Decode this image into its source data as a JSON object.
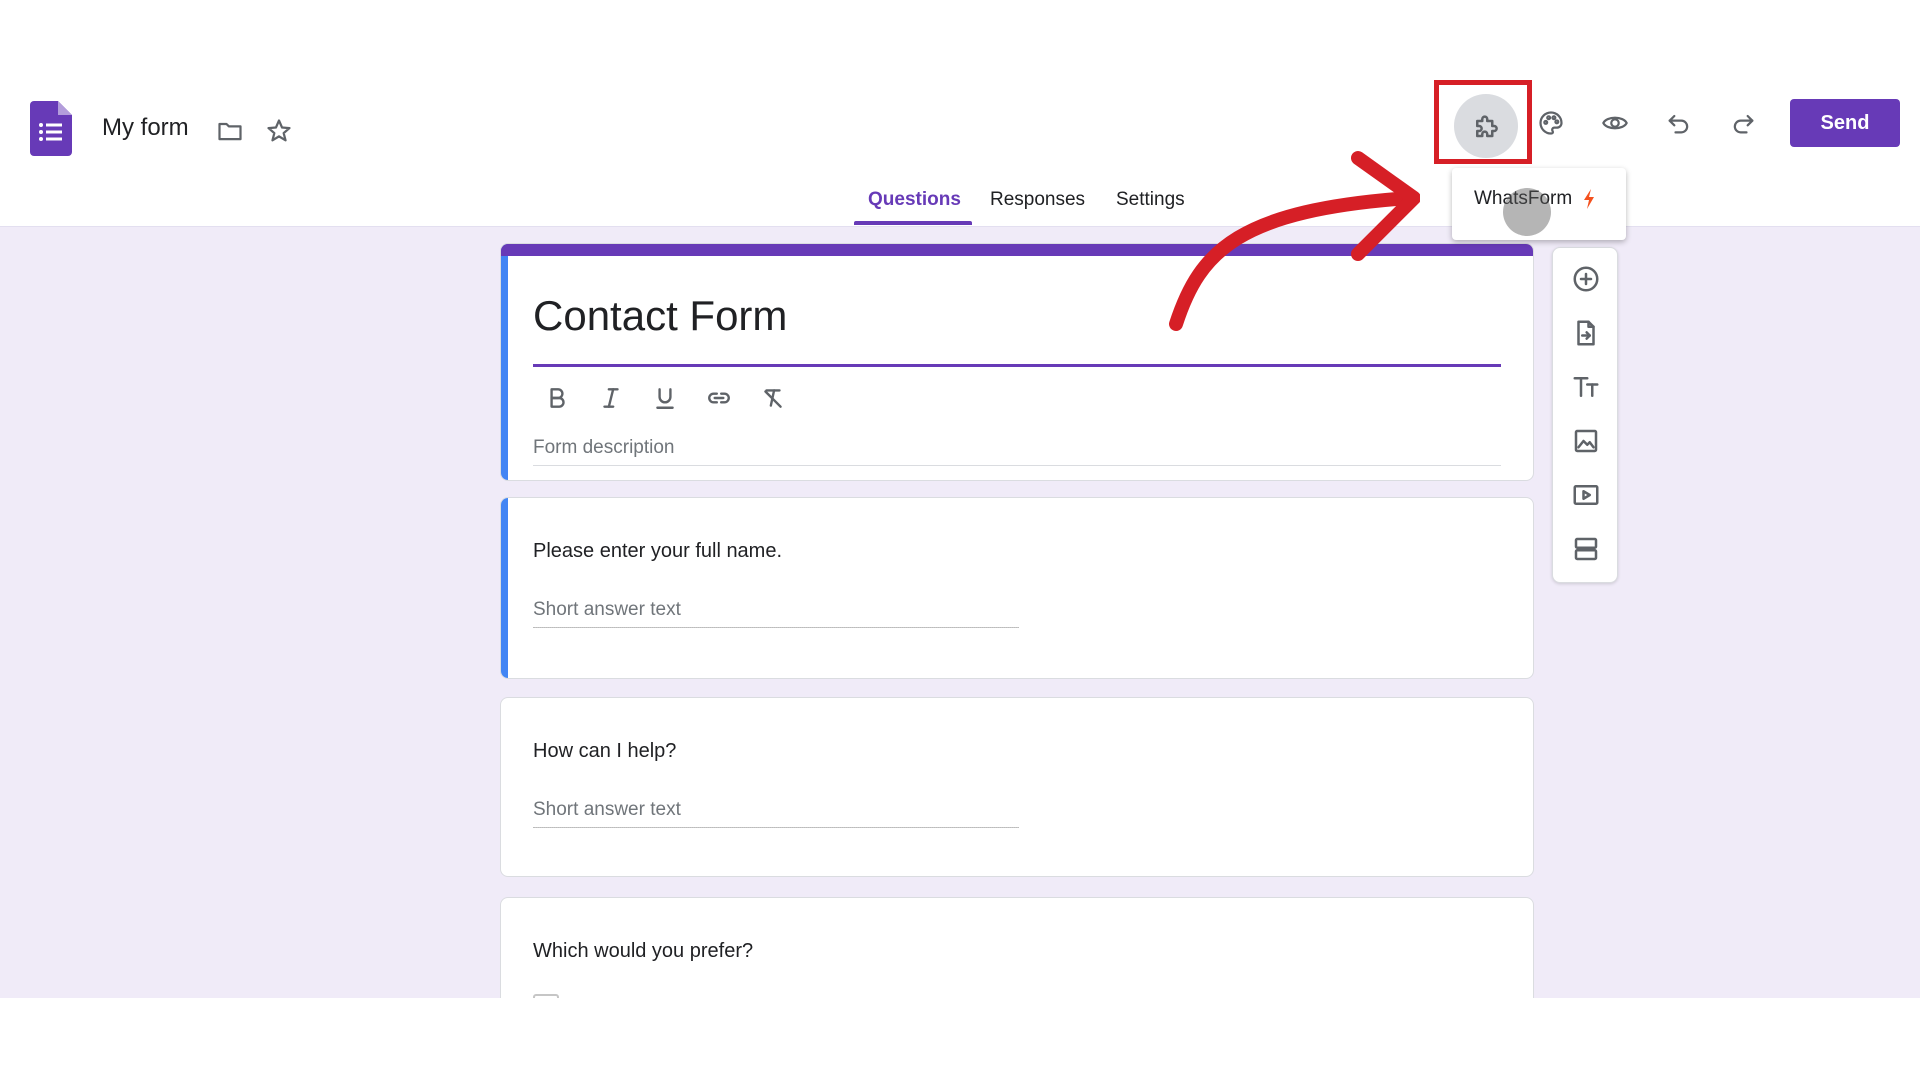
{
  "header": {
    "form_name": "My form",
    "send_label": "Send",
    "icons": [
      "forms-logo-icon",
      "folder-icon",
      "star-icon",
      "addon-puzzle-icon",
      "palette-icon",
      "preview-eye-icon",
      "undo-icon",
      "redo-icon"
    ]
  },
  "tabs": [
    {
      "label": "Questions",
      "active": true
    },
    {
      "label": "Responses",
      "active": false
    },
    {
      "label": "Settings",
      "active": false
    }
  ],
  "addon_menu": {
    "items": [
      {
        "label": "WhatsForm",
        "icon": "bolt-icon"
      }
    ]
  },
  "title_card": {
    "title": "Contact Form",
    "description_placeholder": "Form description",
    "format_tools": [
      "bold-icon",
      "italic-icon",
      "underline-icon",
      "link-icon",
      "clear-format-icon"
    ]
  },
  "questions": [
    {
      "title": "Please enter your full name.",
      "answer_placeholder": "Short answer text"
    },
    {
      "title": "How can I help?",
      "answer_placeholder": "Short answer text"
    },
    {
      "title": "Which would you prefer?"
    }
  ],
  "side_toolbar": [
    "add-question-icon",
    "import-questions-icon",
    "add-title-icon",
    "add-image-icon",
    "add-video-icon",
    "add-section-icon"
  ],
  "colors": {
    "accent": "#673ab7",
    "active_card": "#4285f4",
    "body_bg": "#f0ebf8",
    "annotation": "#d61f26",
    "bolt": "#f4511e"
  }
}
